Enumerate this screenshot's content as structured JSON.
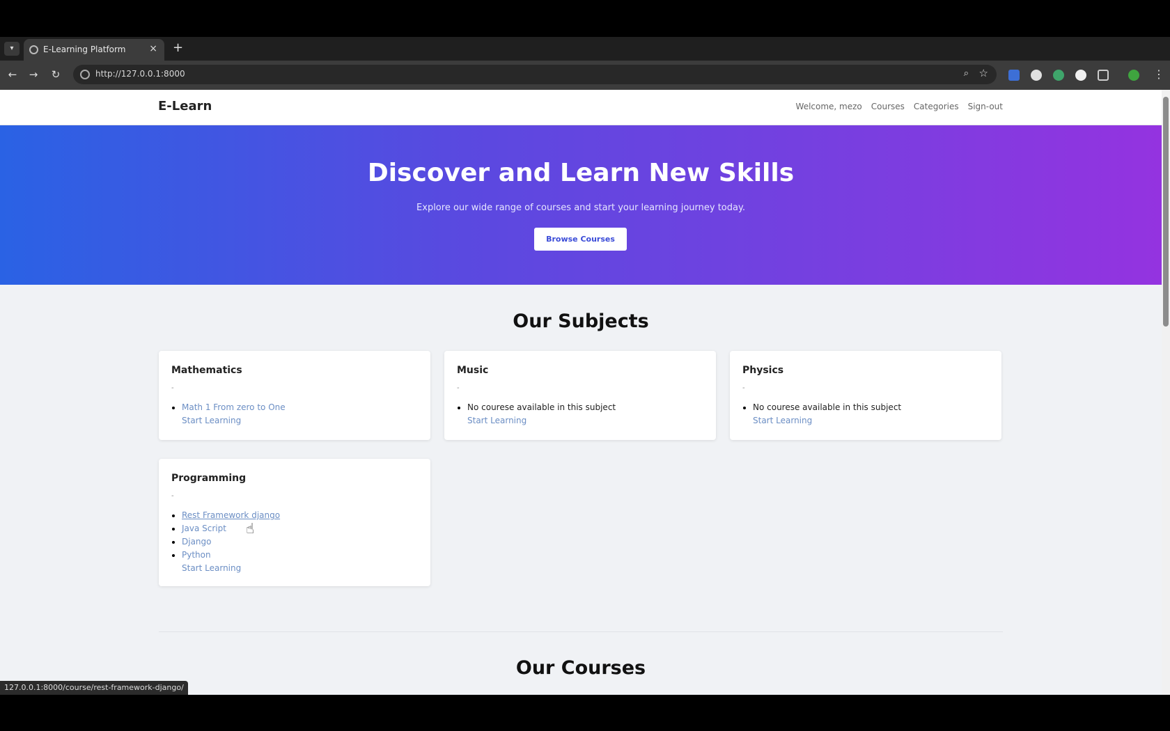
{
  "browser": {
    "tab_title": "E-Learning Platform",
    "url": "http://127.0.0.1:8000",
    "status_url": "127.0.0.1:8000/course/rest-framework-django/"
  },
  "navbar": {
    "brand": "E-Learn",
    "links": [
      "Welcome, mezo",
      "Courses",
      "Categories",
      "Sign-out"
    ]
  },
  "hero": {
    "title": "Discover and Learn New Skills",
    "subtitle": "Explore our wide range of courses and start your learning journey today.",
    "button_label": "Browse Courses"
  },
  "subjects": {
    "heading": "Our Subjects",
    "cards": [
      {
        "title": "Mathematics",
        "desc": "-",
        "courses": [
          "Math 1 From zero to One"
        ],
        "start": "Start Learning"
      },
      {
        "title": "Music",
        "desc": "-",
        "no_course": "No courese available in this subject",
        "start": "Start Learning"
      },
      {
        "title": "Physics",
        "desc": "-",
        "no_course": "No courese available in this subject",
        "start": "Start Learning"
      },
      {
        "title": "Programming",
        "desc": "-",
        "courses": [
          "Rest Framework django",
          "Java Script",
          "Django",
          "Python"
        ],
        "start": "Start Learning"
      }
    ]
  },
  "courses": {
    "heading": "Our Courses"
  }
}
